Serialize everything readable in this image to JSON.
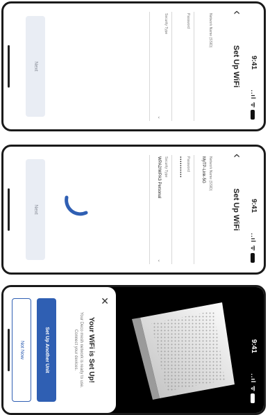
{
  "screens": [
    {
      "status": {
        "time": "9:41",
        "signal": "..ıl ᯤ"
      },
      "title": "Set Up WiFi",
      "fields": [
        {
          "label": "Network Name (SSID)",
          "value": ""
        },
        {
          "label": "Password",
          "value": ""
        },
        {
          "label": "Security Type",
          "value": ""
        }
      ],
      "button": "Next"
    },
    {
      "status": {
        "time": "9:41",
        "signal": "..ıl ᯤ"
      },
      "title": "Set Up WiFi",
      "fields": [
        {
          "label": "Network Name (SSID)",
          "value": "MyTP-Link-5G"
        },
        {
          "label": "Password",
          "value": "••••••••••"
        },
        {
          "label": "Security Type",
          "value": "WPA2/WPA3 Personal"
        }
      ],
      "button": "Next"
    },
    {
      "status": {
        "time": "9:41",
        "signal": "..ıl ᯤ"
      },
      "heading": "Your WiFi is Set Up!",
      "body": "Your Deco mesh network is ready to use. Connect your devices.",
      "primary_button": "Set Up Another Unit",
      "secondary_button": "Not Now"
    }
  ],
  "colors": {
    "accent": "#2f5fb3",
    "button_light": "#e9edf4"
  }
}
